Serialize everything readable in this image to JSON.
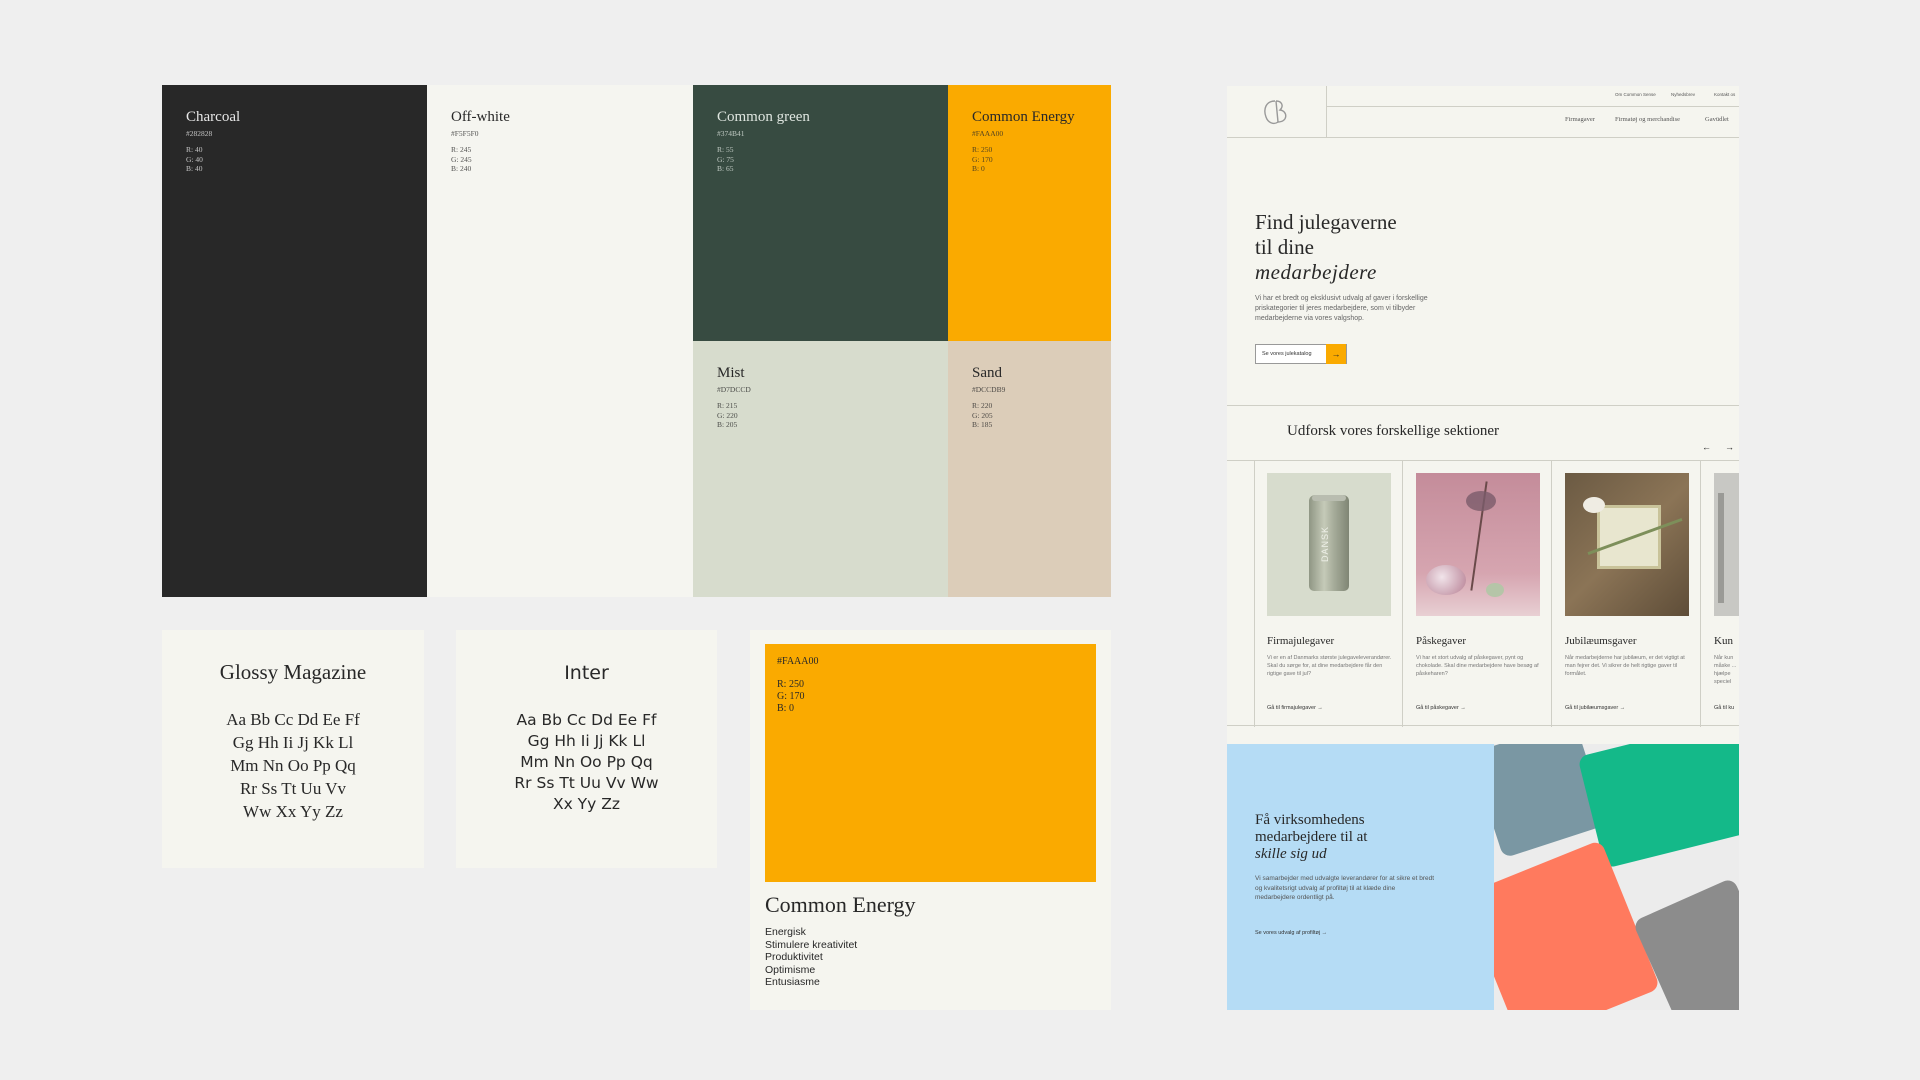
{
  "swatches": {
    "charcoal": {
      "name": "Charcoal",
      "hex": "#282828",
      "r": "R: 40",
      "g": "G: 40",
      "b": "B: 40",
      "color": "#282828"
    },
    "offwhite": {
      "name": "Off-white",
      "hex": "#F5F5F0",
      "r": "R: 245",
      "g": "G: 245",
      "b": "B: 240",
      "color": "#F5F5F0"
    },
    "green": {
      "name": "Common green",
      "hex": "#374B41",
      "r": "R: 55",
      "g": "G: 75",
      "b": "B: 65",
      "color": "#374B41"
    },
    "energy": {
      "name": "Common Energy",
      "hex": "#FAAA00",
      "r": "R: 250",
      "g": "G: 170",
      "b": "B: 0",
      "color": "#FAAA00"
    },
    "mist": {
      "name": "Mist",
      "hex": "#D7DCCD",
      "r": "R: 215",
      "g": "G: 220",
      "b": "B: 205",
      "color": "#D7DCCD"
    },
    "sand": {
      "name": "Sand",
      "hex": "#DCCDB9",
      "r": "R: 220",
      "g": "G: 205",
      "b": "B: 185",
      "color": "#DCCDB9"
    }
  },
  "type_glossy": {
    "title": "Glossy Magazine",
    "lines": [
      "Aa Bb Cc Dd Ee Ff",
      "Gg Hh Ii Jj Kk Ll",
      "Mm Nn Oo Pp Qq",
      "Rr Ss Tt Uu Vv",
      "Ww Xx Yy Zz"
    ]
  },
  "type_inter": {
    "title": "Inter",
    "lines": [
      "Aa Bb Cc Dd Ee Ff",
      "Gg Hh Ii Jj Kk Ll",
      "Mm Nn Oo Pp Qq",
      "Rr Ss Tt Uu Vv Ww",
      "Xx Yy Zz"
    ]
  },
  "energy_card": {
    "hex": "#FAAA00",
    "r": "R: 250",
    "g": "G: 170",
    "b": "B: 0",
    "title": "Common Energy",
    "keywords": [
      "Energisk",
      "Stimulere kreativitet",
      "Produktivitet",
      "Optimisme",
      "Entusiasme"
    ]
  },
  "website": {
    "nav_top": [
      "Om Common Sense",
      "Nyhedsbrev",
      "Kontakt os"
    ],
    "nav_main": [
      "Firmagaver",
      "Firmatøj og merchandise",
      "Gavüdlet"
    ],
    "hero": {
      "line1": "Find julegaverne",
      "line2": "til dine",
      "line3": "medarbejdere",
      "body": "Vi har et bredt og eksklusivt udvalg af gaver i forskellige priskategorier til jeres medarbejdere, som vi tilbyder medarbejderne via vores valgshop.",
      "button": "Se vores julekatalog",
      "arrow": "→"
    },
    "section_title": "Udforsk vores forskellige sektioner",
    "prev_arrow": "←",
    "next_arrow": "→",
    "cards": [
      {
        "title": "Firmajulegaver",
        "desc": "Vi er en af Danmarks største julegaveleverandører. Skal du sørge for, at dine medarbejdere får den rigtige gave til jul?",
        "link": "Gå til firmajulegaver →",
        "can_text": "DANSK"
      },
      {
        "title": "Påskegaver",
        "desc": "Vi har et stort udvalg af påskegaver, pynt og chokolade. Skal dine medarbejdere have besøg af påskeharen?",
        "link": "Gå til påskegaver →"
      },
      {
        "title": "Jubilæumsgaver",
        "desc": "Når medarbejderne har jubilæum, er det vigtigt at man fejrer det. Vi sikrer de helt rigtige gaver til formålet.",
        "link": "Gå til jubilæumsgaver →"
      },
      {
        "title": "Kun",
        "desc": "Når kun måske ... hjælpe speciel",
        "link": "Gå til ku"
      }
    ],
    "promo": {
      "line1": "Få virksomhedens",
      "line2": "medarbejdere til at",
      "line3": "skille sig ud",
      "body": "Vi samarbejder med udvalgte leverandører for at sikre et bredt og kvalitetsrigt udvalg af profiltøj til at klæde dine medarbejdere ordentligt på.",
      "link": "Se vores udvalg af profiltøj →",
      "bg": "#B5DCF5"
    }
  }
}
